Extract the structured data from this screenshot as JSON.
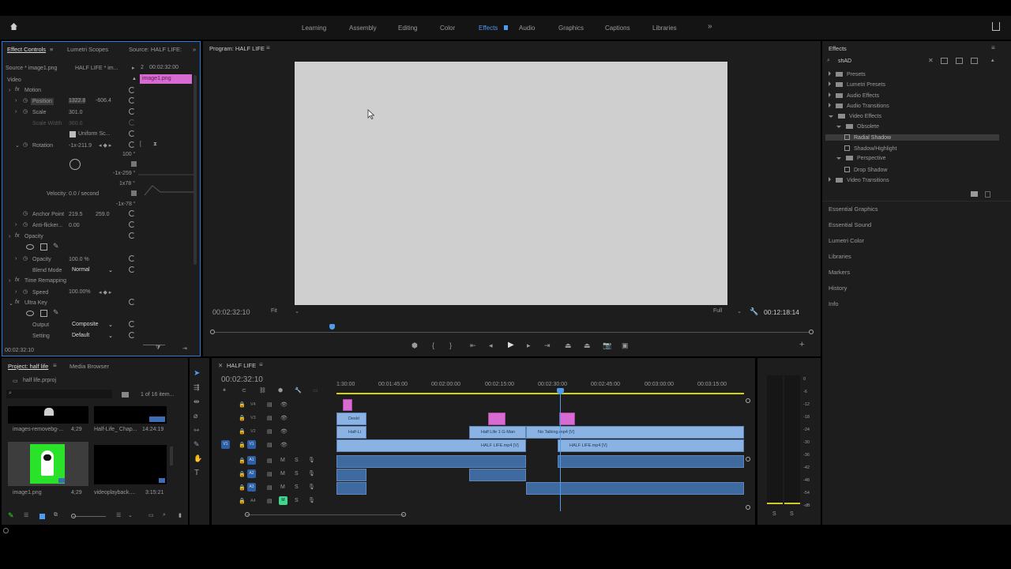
{
  "workspaces": [
    "Learning",
    "Assembly",
    "Editing",
    "Color",
    "Effects",
    "Audio",
    "Graphics",
    "Captions",
    "Libraries"
  ],
  "active_workspace": "Effects",
  "effect_controls": {
    "tabs": [
      "Effect Controls",
      "Lumetri Scopes",
      "Source: HALF LIFE:"
    ],
    "source_label": "Source * image1.png",
    "sequence_label": "HALF LIFE * im...",
    "timecode": "00:02:32:00",
    "clip_name": "image1.png",
    "video_label": "Video",
    "motion": "Motion",
    "position_label": "Position",
    "position_x": "1322.8",
    "position_y": "-606.4",
    "scale_label": "Scale",
    "scale_value": "301.0",
    "scale_width_label": "Scale Width",
    "scale_width_value": "360.0",
    "uniform_scale": "Uniform Sc...",
    "rotation_label": "Rotation",
    "rotation_value": "-1x-211.9",
    "graph_top": "100 °",
    "graph_a": "-1x-259 °",
    "graph_b": "1x78 °",
    "graph_c": "-1x-78 °",
    "velocity": "Velocity: 0.0 / second",
    "anchor_label": "Anchor Point",
    "anchor_x": "219.5",
    "anchor_y": "259.0",
    "antiflicker_label": "Anti-flicker...",
    "antiflicker_value": "0.00",
    "opacity_group": "Opacity",
    "opacity_label": "Opacity",
    "opacity_value": "100.0 %",
    "blend_label": "Blend Mode",
    "blend_value": "Normal",
    "time_remap": "Time Remapping",
    "speed_label": "Speed",
    "speed_value": "100.00%",
    "ultra_key": "Ultra Key",
    "output_label": "Output",
    "output_value": "Composite",
    "setting_label": "Setting",
    "setting_value": "Default",
    "bottom_timecode": "00:02:32:10"
  },
  "program": {
    "title": "Program: HALF LIFE",
    "timecode": "00:02:32:10",
    "fit": "Fit",
    "quality": "Full",
    "duration": "00:12:18:14"
  },
  "effects": {
    "title": "Effects",
    "search_value": "shAD",
    "tree": [
      {
        "label": "Presets",
        "level": 0,
        "kind": "folder"
      },
      {
        "label": "Lumetri Presets",
        "level": 0,
        "kind": "folder"
      },
      {
        "label": "Audio Effects",
        "level": 0,
        "kind": "folder"
      },
      {
        "label": "Audio Transitions",
        "level": 0,
        "kind": "folder"
      },
      {
        "label": "Video Effects",
        "level": 0,
        "kind": "folder",
        "open": true
      },
      {
        "label": "Obsolete",
        "level": 1,
        "kind": "folder",
        "open": true
      },
      {
        "label": "Radial Shadow",
        "level": 2,
        "kind": "effect",
        "selected": true
      },
      {
        "label": "Shadow/Highlight",
        "level": 2,
        "kind": "effect"
      },
      {
        "label": "Perspective",
        "level": 1,
        "kind": "folder",
        "open": true
      },
      {
        "label": "Drop Shadow",
        "level": 2,
        "kind": "effect"
      },
      {
        "label": "Video Transitions",
        "level": 0,
        "kind": "folder"
      }
    ],
    "panels": [
      "Essential Graphics",
      "Essential Sound",
      "Lumetri Color",
      "Libraries",
      "Markers",
      "History",
      "Info"
    ]
  },
  "project": {
    "tabs": [
      "Project: half life",
      "Media Browser"
    ],
    "file": "half life.prproj",
    "count": "1 of 16 item...",
    "items": [
      {
        "name": "images-removebg-...",
        "duration": "4;29"
      },
      {
        "name": "Half-Life_ Chap...",
        "duration": "14:24:19"
      },
      {
        "name": "image1.png",
        "duration": "4;29"
      },
      {
        "name": "videoplayback....",
        "duration": "3:15:21"
      }
    ]
  },
  "timeline": {
    "title": "HALF LIFE",
    "timecode": "00:02:32:10",
    "ruler": [
      "1:30:00",
      "00:01:45:00",
      "00:02:00:00",
      "00:02:15:00",
      "00:02:30:00",
      "00:02:45:00",
      "00:03:00:00",
      "00:03:15:00"
    ],
    "video_tracks": [
      "V4",
      "V3",
      "V2",
      "V1"
    ],
    "audio_tracks": [
      "A1",
      "A2",
      "A3",
      "A4"
    ],
    "source_patch": "V1",
    "clips": {
      "v3_a": "Deskt",
      "v2_a": "Half-Li",
      "v2_b": "Half Life 1 G-Man",
      "v2_c": "No Talking.mp4 [V]",
      "v1_a": "HALF LIFE.mp4 [V]",
      "v1_b": "HALF LIFE.mp4 [V]"
    }
  },
  "meter": {
    "scale": [
      "0",
      "-6",
      "-12",
      "-18",
      "-24",
      "-30",
      "-36",
      "-42",
      "-48",
      "-54",
      "-dB"
    ],
    "solo": [
      "S",
      "S"
    ]
  }
}
